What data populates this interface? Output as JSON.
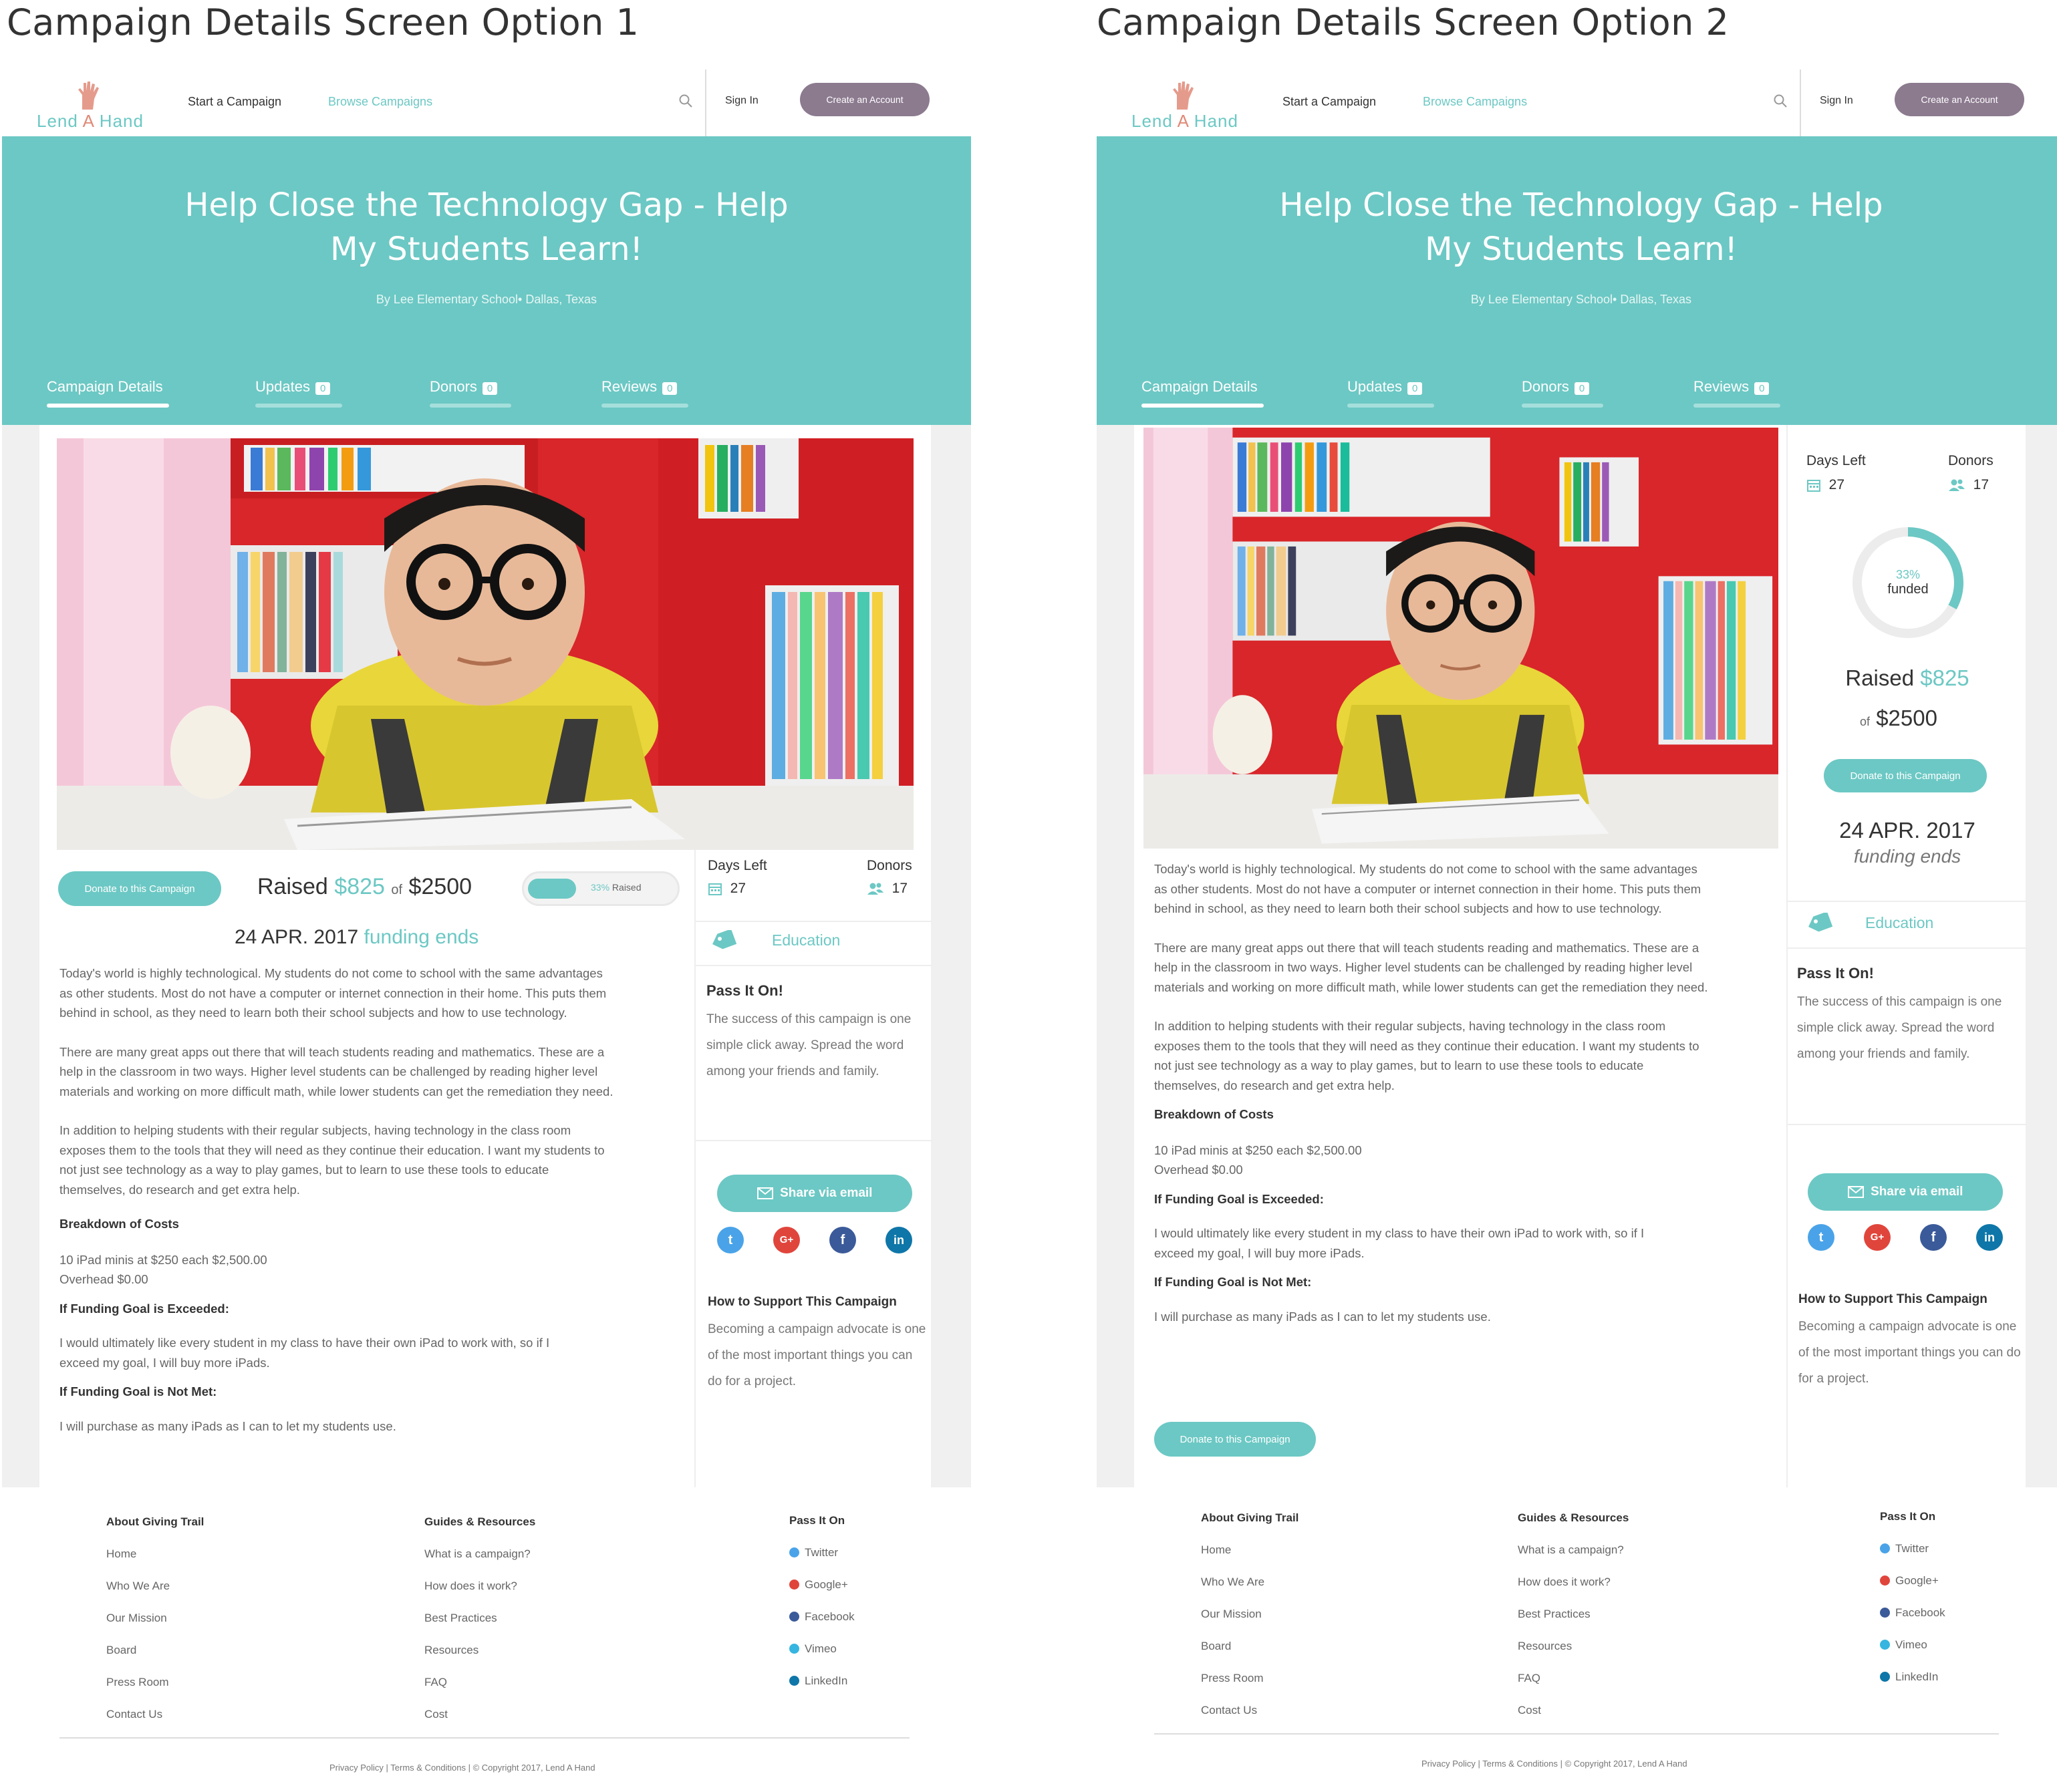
{
  "option1_title": "Campaign Details Screen Option  1",
  "option2_title": "Campaign Details Screen Option 2",
  "header": {
    "logo_text_1": "Lend",
    "logo_text_a": "A",
    "logo_text_2": "Hand",
    "nav_start": "Start a Campaign",
    "nav_browse": "Browse Campaigns",
    "sign_in": "Sign In",
    "create_account": "Create an Account"
  },
  "hero": {
    "title": "Help Close the Technology Gap - Help My Students Learn!",
    "byline": "By Lee Elementary School• Dallas, Texas"
  },
  "tabs": [
    {
      "label": "Campaign Details",
      "count": ""
    },
    {
      "label": "Updates",
      "count": "0"
    },
    {
      "label": "Donors",
      "count": "0"
    },
    {
      "label": "Reviews",
      "count": "0"
    }
  ],
  "campaign": {
    "donate_label": "Donate to this Campaign",
    "raised_label": "Raised",
    "raised_amount": "$825",
    "of_label": "of",
    "goal_amount": "$2500",
    "progress_percent": 33,
    "progress_pct_text": "33%",
    "progress_raised_text": "Raised",
    "funded_text": "funded",
    "date": "24 APR. 2017",
    "funding_ends": "funding ends",
    "days_left_label": "Days Left",
    "days_left_value": "27",
    "donors_label": "Donors",
    "donors_value": "17",
    "category": "Education"
  },
  "description": {
    "p1": "Today's world is highly technological. My students do not come to school with the same advantages as other students. Most do not have a computer or internet connection in their home. This puts them behind in school, as they need to learn both their school subjects and how to use technology.",
    "p2": "There are many great apps out there that will teach students reading and mathematics. These are a help in the classroom in two ways. Higher level students can be challenged by reading higher level materials and working on more difficult math, while lower students can get the remediation they need.",
    "p3": "In addition to helping students with their regular subjects, having technology in the class room exposes them to the tools that they will need as they continue their education. I want my students to not just see technology as a way to play games, but to learn to use these tools to educate themselves, do research and get extra help.",
    "costs_heading": "Breakdown of Costs",
    "cost_1": "10 iPad minis at $250 each $2,500.00",
    "cost_2": "Overhead $0.00",
    "exceeded_heading": "If Funding Goal is Exceeded:",
    "exceeded_text": "I would ultimately like every student in my class to have their own iPad to work with, so if I exceed my goal, I will buy more iPads.",
    "notmet_heading": "If Funding Goal is Not Met:",
    "notmet_text": "I will purchase as many iPads as I can to let my students use."
  },
  "sidebar": {
    "pass_heading": "Pass It On!",
    "pass_text": "The success of this campaign is one simple click away. Spread the word among your friends and family.",
    "share_email": "Share via email",
    "how_heading": "How to Support This Campaign",
    "how_text": "Becoming a campaign advocate is one of the most important things you can do for a project."
  },
  "footer": {
    "col1_heading": "About Giving Trail",
    "col1_links": [
      "Home",
      "Who We Are",
      "Our Mission",
      "Board",
      "Press Room",
      "Contact Us"
    ],
    "col2_heading": "Guides & Resources",
    "col2_links": [
      "What is a campaign?",
      "How does it work?",
      "Best Practices",
      "Resources",
      "FAQ",
      "Cost"
    ],
    "col3_heading": "Pass It On",
    "col3_links": [
      "Twitter",
      "Google+",
      "Facebook",
      "Vimeo",
      "LinkedIn"
    ],
    "social_colors": [
      "#4aa3e8",
      "#e0453c",
      "#3b5a9a",
      "#36b5e0",
      "#0e76a8"
    ],
    "legal": "Privacy Policy  |  Terms & Conditions  |  © Copyright 2017, Lend A Hand"
  },
  "colors": {
    "accent": "#6cc8c4",
    "create_button": "#8c7a8f",
    "logo_a": "#e08a78"
  }
}
